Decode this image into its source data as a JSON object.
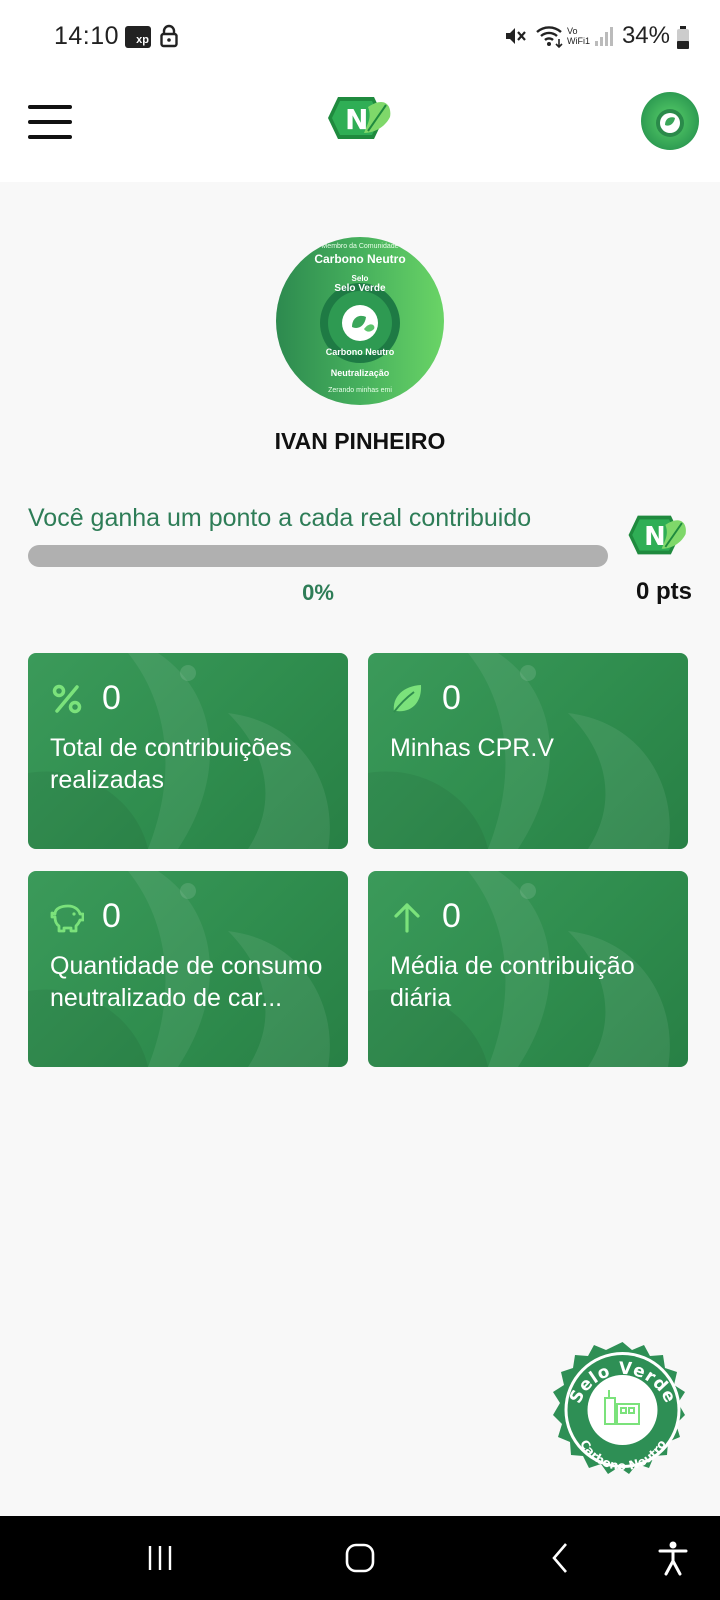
{
  "status_bar": {
    "time": "14:10",
    "badge": "xp",
    "battery": "34%",
    "wifi_label_top": "Vo",
    "wifi_label_bottom": "WiFi1"
  },
  "app_bar": {
    "logo_letter": "N"
  },
  "profile": {
    "name": "IVAN PINHEIRO",
    "avatar_line1": "Membro da Comunidade",
    "avatar_line2": "Carbono Neutro",
    "avatar_line3": "Selo",
    "avatar_seal_top": "Selo Verde",
    "avatar_seal_bottom": "Carbono Neutro",
    "avatar_line4": "Neutralização",
    "avatar_line5": "Zerando minhas emi"
  },
  "points": {
    "description": "Você ganha um ponto a cada real contribuido",
    "progress_value": 0,
    "progress_label": "0%",
    "points_label": "0 pts"
  },
  "cards": [
    {
      "icon": "percent-icon",
      "value": "0",
      "label": "Total de contribuições realizadas"
    },
    {
      "icon": "leaf-icon",
      "value": "0",
      "label": "Minhas CPR.V"
    },
    {
      "icon": "piggy-bank-icon",
      "value": "0",
      "label": "Quantidade de consumo neutralizado de car..."
    },
    {
      "icon": "arrow-up-icon",
      "value": "0",
      "label": "Média de contribuição diária"
    }
  ],
  "seal": {
    "top_text": "Selo Verde",
    "bottom_text": "Carbono Neutro"
  },
  "colors": {
    "accent": "#2e9c52",
    "text_green": "#2e7d57",
    "icon_green": "#7be27b"
  }
}
